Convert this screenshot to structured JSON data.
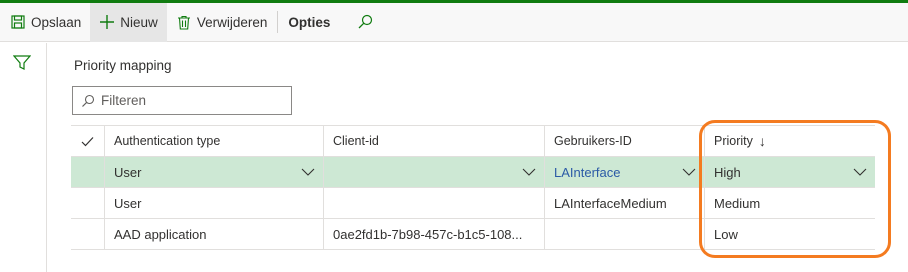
{
  "toolbar": {
    "save_label": "Opslaan",
    "new_label": "Nieuw",
    "delete_label": "Verwijderen",
    "options_label": "Opties"
  },
  "section_title": "Priority mapping",
  "filter": {
    "placeholder": "Filteren"
  },
  "grid": {
    "columns": [
      "Authentication type",
      "Client-id",
      "Gebruikers-ID",
      "Priority"
    ],
    "sort_indicator": "↓",
    "rows": [
      {
        "authentication_type": "User",
        "client_id": "",
        "user_id": "LAInterface",
        "priority": "High",
        "selected": true
      },
      {
        "authentication_type": "User",
        "client_id": "",
        "user_id": "LAInterfaceMedium",
        "priority": "Medium",
        "selected": false
      },
      {
        "authentication_type": "AAD application",
        "client_id": "0ae2fd1b-7b98-457c-b1c5-108...",
        "user_id": "",
        "priority": "Low",
        "selected": false
      }
    ]
  },
  "colors": {
    "accent_bar": "#107c10",
    "selected_row": "#cde8d4",
    "highlight": "#f47b20",
    "link": "#2b5aa6"
  }
}
